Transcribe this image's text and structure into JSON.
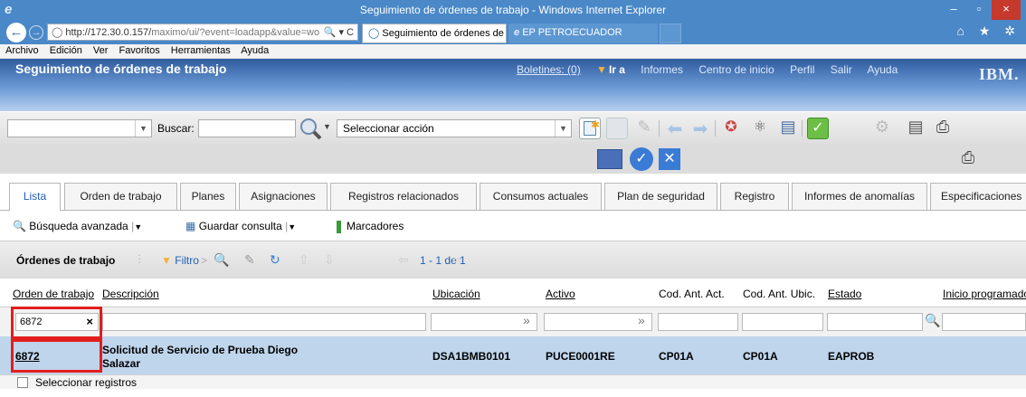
{
  "window": {
    "title": "Seguimiento de órdenes de trabajo - Windows Internet Explorer",
    "min": "–",
    "restore": "▫",
    "close": "×"
  },
  "browser": {
    "address_prefix": "http://172.30.0.157/",
    "address_rest": "maximo/ui/?event=loadapp&value=wo",
    "address_tools": "🔍 ▾ C",
    "tabs": [
      "Seguimiento de órdenes de ... ×",
      "EP PETROECUADOR"
    ],
    "menu": [
      "Archivo",
      "Edición",
      "Ver",
      "Favoritos",
      "Herramientas",
      "Ayuda"
    ],
    "right_icons": "⌂ ★ ✲"
  },
  "header": {
    "app_title": "Seguimiento de órdenes de trabajo",
    "boletines": "Boletines: (0)",
    "ira": "Ir a",
    "links": [
      "Informes",
      "Centro de inicio",
      "Perfil",
      "Salir",
      "Ayuda"
    ],
    "logo": "IBM."
  },
  "toolbar": {
    "buscar_label": "Buscar:",
    "accion_placeholder": "Seleccionar acción"
  },
  "tabs": [
    {
      "label": "Lista"
    },
    {
      "label": "Orden de trabajo"
    },
    {
      "label": "Planes"
    },
    {
      "label": "Asignaciones"
    },
    {
      "label": "Registros relacionados"
    },
    {
      "label": "Consumos actuales"
    },
    {
      "label": "Plan de seguridad"
    },
    {
      "label": "Registro"
    },
    {
      "label": "Informes de anomalías"
    },
    {
      "label": "Especificaciones"
    }
  ],
  "linkbar": {
    "busqueda": "Búsqueda avanzada",
    "guardar": "Guardar consulta",
    "marcadores": "Marcadores"
  },
  "table": {
    "title": "Órdenes de trabajo",
    "filtro": "Filtro",
    "pager": "1 - 1 de 1",
    "columns": [
      "Orden de trabajo",
      "Descripción",
      "Ubicación",
      "Activo",
      "Cod. Ant. Act.",
      "Cod. Ant. Ubic.",
      "Estado",
      "Inicio programado"
    ],
    "filter_value": "6872",
    "filter_clear": "×",
    "row": {
      "orden": "6872",
      "descripcion_1": "Solicitud de Servicio de Prueba Diego",
      "descripcion_2": "Salazar",
      "ubicacion": "DSA1BMB0101",
      "activo": "PUCE0001RE",
      "cod_act": "CP01A",
      "cod_ubic": "CP01A",
      "estado": "EAPROB"
    },
    "select_label": "Seleccionar registros"
  }
}
